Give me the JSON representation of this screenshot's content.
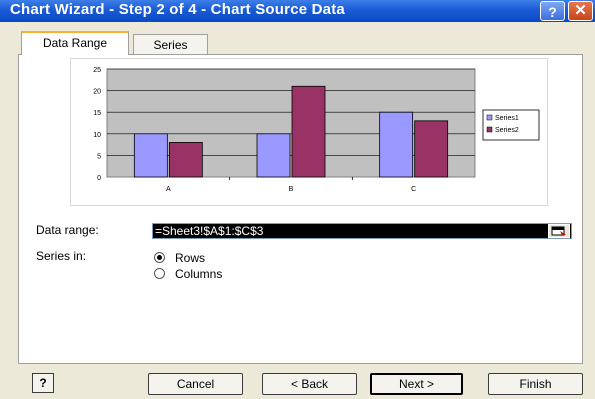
{
  "window": {
    "title": "Chart Wizard - Step 2 of 4 - Chart Source Data",
    "help_glyph": "?",
    "close_glyph": "✕"
  },
  "tabs": [
    {
      "label": "Data Range",
      "active": true
    },
    {
      "label": "Series",
      "active": false
    }
  ],
  "chart_data": {
    "type": "bar",
    "categories": [
      "A",
      "B",
      "C"
    ],
    "series": [
      {
        "name": "Series1",
        "values": [
          10,
          10,
          15
        ],
        "color": "#9999ff"
      },
      {
        "name": "Series2",
        "values": [
          8,
          21,
          13
        ],
        "color": "#993366"
      }
    ],
    "ylim": [
      0,
      25
    ],
    "yticks": [
      "0",
      "5",
      "10",
      "15",
      "20",
      "25"
    ],
    "grid": true,
    "legend": "right",
    "plot_background": "#c0c0c0"
  },
  "form": {
    "data_range_label": "Data range:",
    "data_range_value": "=Sheet3!$A$1:$C$3",
    "series_in_label": "Series in:",
    "options": [
      {
        "label": "Rows",
        "selected": true
      },
      {
        "label": "Columns",
        "selected": false
      }
    ]
  },
  "buttons": {
    "help_label": "?",
    "cancel": "Cancel",
    "back": "< Back",
    "next": "Next >",
    "finish": "Finish"
  }
}
